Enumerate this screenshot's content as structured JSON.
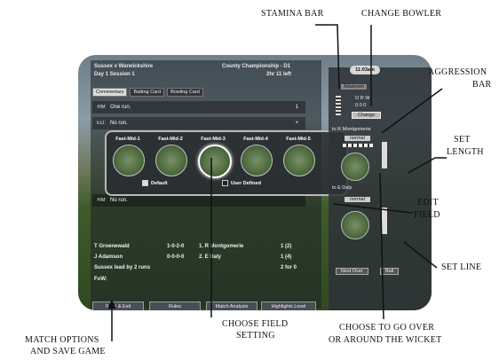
{
  "game": {
    "match_title": "Sussex v Warwickshire",
    "competition": "County Championship - D1",
    "session": "Day 1 Session 1",
    "time_left": "2hr 11 left",
    "clock": "11:03am",
    "tabs": [
      {
        "label": "Commentary",
        "active": true
      },
      {
        "label": "Batting Card",
        "active": false
      },
      {
        "label": "Bowling Card",
        "active": false
      }
    ],
    "commentary": [
      {
        "code": "RM",
        "text": "One run.",
        "marker": "1"
      },
      {
        "code": "ED:",
        "text": "No run.",
        "marker": "+"
      },
      {
        "code": "RM",
        "text": "No run.",
        "marker": ""
      }
    ],
    "field_settings": {
      "options": [
        "Fast-Mid-1",
        "Fast-Mid-2",
        "Fast-Mid-3",
        "Fast-Mid-4",
        "Fast-Mid-5"
      ],
      "selected_index": 2,
      "default_label": "Default",
      "user_defined_label": "User Defined",
      "mode": "Default"
    },
    "batsmen": [
      {
        "name": "T Groenewald",
        "figures": "1-0-2-0",
        "opponent": "1. R Montgomerie",
        "score": "1 (2)"
      },
      {
        "name": "J Adamson",
        "figures": "0-0-0-0",
        "opponent": "2. E Daly",
        "score": "1 (4)"
      }
    ],
    "lead_text": "Sussex lead by 2 runs",
    "total": "2 for 0",
    "fow_label": "FoW:",
    "bottom_buttons": [
      "Save & Exit",
      "Rules",
      "Match Analysis",
      "Highlights Level"
    ],
    "right_panel": {
      "bowler_name": "Adamson",
      "change_label": "Change",
      "stats_header": "O   R   W",
      "stats_values": "0   0   0",
      "to_batsman_1": "to R Montgomerie",
      "to_batsman_2": "to E Daly",
      "aggression_1": "normal",
      "aggression_2": "normal",
      "next_over_label": "Next Over",
      "ball_label": "Ball"
    }
  },
  "annotations": {
    "stamina_bar": "STAMINA BAR",
    "change_bowler": "CHANGE BOWLER",
    "aggression_bar_1": "AGGRESSION",
    "aggression_bar_2": "BAR",
    "set_length_1": "SET",
    "set_length_2": "LENGTH",
    "edit_field_1": "EDIT",
    "edit_field_2": "FIELD",
    "set_line": "SET LINE",
    "choose_field_1": "CHOOSE FIELD",
    "choose_field_2": "SETTING",
    "choose_over_1": "CHOOSE TO GO OVER",
    "choose_over_2": "OR AROUND THE WICKET",
    "match_options_1": "MATCH OPTIONS",
    "match_options_2": "AND SAVE GAME"
  }
}
